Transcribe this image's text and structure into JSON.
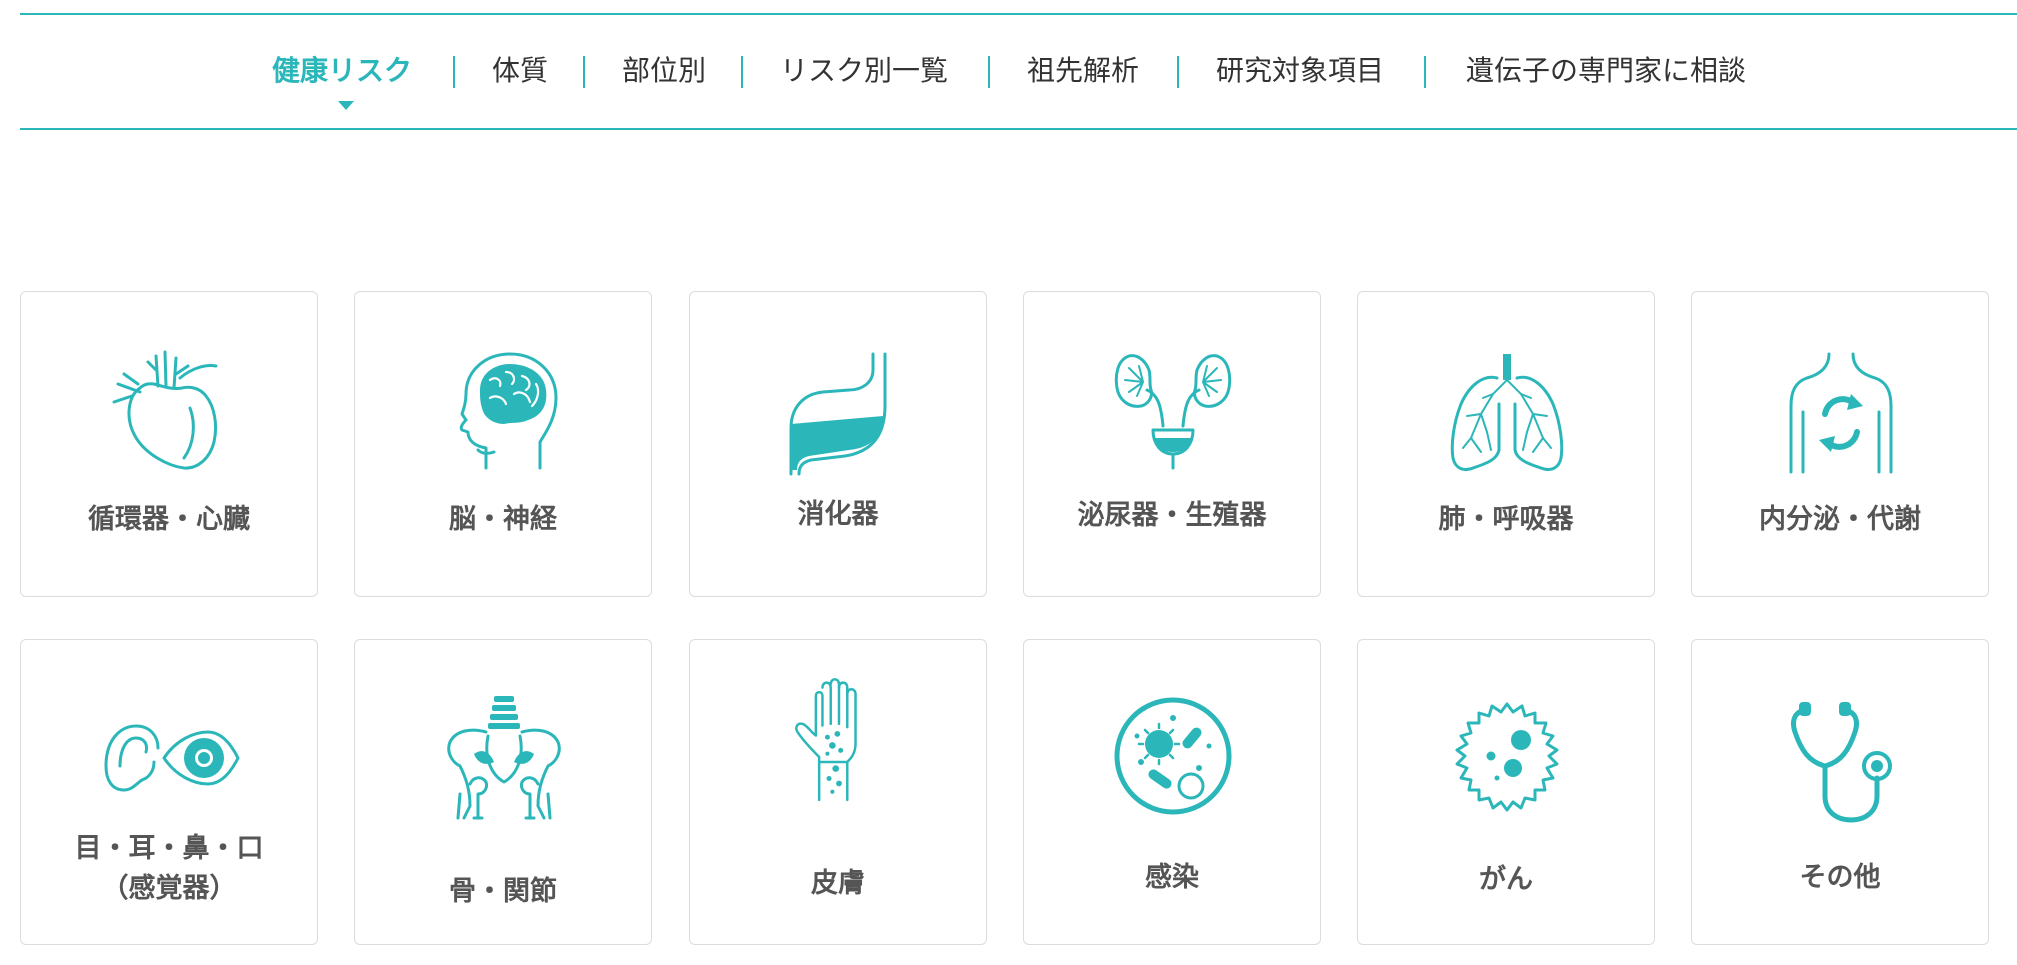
{
  "tabs": [
    {
      "label": "健康リスク",
      "active": true
    },
    {
      "label": "体質"
    },
    {
      "label": "部位別"
    },
    {
      "label": "リスク別一覧"
    },
    {
      "label": "祖先解析"
    },
    {
      "label": "研究対象項目"
    },
    {
      "label": "遺伝子の専門家に相談"
    }
  ],
  "categories": [
    {
      "label": "循環器・心臓",
      "icon": "heart-icon"
    },
    {
      "label": "脳・神経",
      "icon": "brain-icon"
    },
    {
      "label": "消化器",
      "icon": "stomach-icon"
    },
    {
      "label": "泌尿器・生殖器",
      "icon": "kidney-bladder-icon"
    },
    {
      "label": "肺・呼吸器",
      "icon": "lungs-icon"
    },
    {
      "label": "内分泌・代謝",
      "icon": "metabolism-cycle-icon"
    },
    {
      "label": "目・耳・鼻・口",
      "label_line2": "（感覚器）",
      "icon": "ear-eye-icon"
    },
    {
      "label": "骨・関節",
      "icon": "pelvis-bone-icon"
    },
    {
      "label": "皮膚",
      "icon": "skin-hand-icon"
    },
    {
      "label": "感染",
      "icon": "bacteria-icon"
    },
    {
      "label": "がん",
      "icon": "cancer-cell-icon"
    },
    {
      "label": "その他",
      "icon": "stethoscope-icon"
    }
  ],
  "colors": {
    "accent": "#2bb7ba",
    "text": "#333333",
    "card_label": "#555555",
    "card_border": "#dcdcdc"
  }
}
